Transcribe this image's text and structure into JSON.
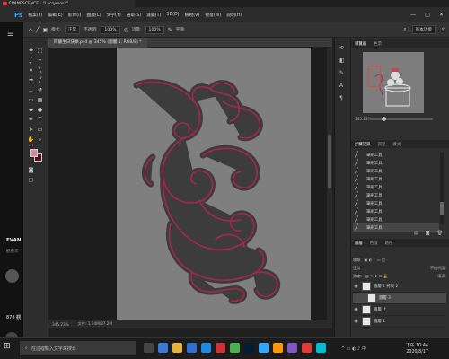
{
  "titlebar": {
    "tab_title": "EVANESCENCE - \"Lacrymosa\""
  },
  "menubar": {
    "logo": "Ps",
    "items": [
      "檔案(F)",
      "編輯(E)",
      "影像(I)",
      "圖層(L)",
      "文字(Y)",
      "選取(S)",
      "濾鏡(T)",
      "3D(D)",
      "檢視(V)",
      "視窗(W)",
      "說明(H)"
    ],
    "window_controls": [
      "—",
      "□",
      "✕"
    ]
  },
  "options_bar": {
    "mode_label": "模式:",
    "mode_value": "正常",
    "opacity_label": "不透明:",
    "opacity_value": "100%",
    "flow_label": "流量:",
    "flow_value": "100%",
    "smooth_label": "平滑:",
    "workspace": "基本功能"
  },
  "document": {
    "tab_title": "阿蘭生日快樂.psd @ 345% (圖層 1, RGB/8) *",
    "status_zoom": "345.23%",
    "status_size": "文件: 1.64M/37.2M"
  },
  "colors": {
    "foreground": "#d38ca0",
    "background": "#5a0e1c",
    "canvas": "#7f7f7f",
    "ornament_fill": "#3c3c3c",
    "ornament_line": "#a8264e"
  },
  "left_strip": {
    "channel": "EVAN",
    "subtitle": "觀看次",
    "count": "878 觀"
  },
  "navigator": {
    "tabs": [
      "導覽器",
      "色票"
    ],
    "zoom": "345.23%"
  },
  "history": {
    "tabs": [
      "步驟記錄",
      "調整",
      "樣式"
    ],
    "items": [
      "筆刷工具",
      "筆刷工具",
      "筆刷工具",
      "筆刷工具",
      "筆刷工具",
      "筆刷工具",
      "筆刷工具",
      "筆刷工具",
      "筆刷工具",
      "筆刷工具"
    ]
  },
  "layers": {
    "tabs": [
      "圖層",
      "色版",
      "路徑"
    ],
    "kind_label": "種類",
    "blend": "正常",
    "opacity_label": "不透明度:",
    "lock_label": "鎖定:",
    "fill_label": "填滿:",
    "rows": [
      {
        "name": "圖層 1 拷貝 2"
      },
      {
        "name": "圖層 3"
      },
      {
        "name": "圖層 上"
      },
      {
        "name": "圖層 1"
      }
    ],
    "status": "調查 修復: 1536 拍三 1"
  },
  "taskbar": {
    "search_placeholder": "在這裡輸入文字來搜尋",
    "time": "下午 10:44",
    "date": "2020/8/17"
  }
}
